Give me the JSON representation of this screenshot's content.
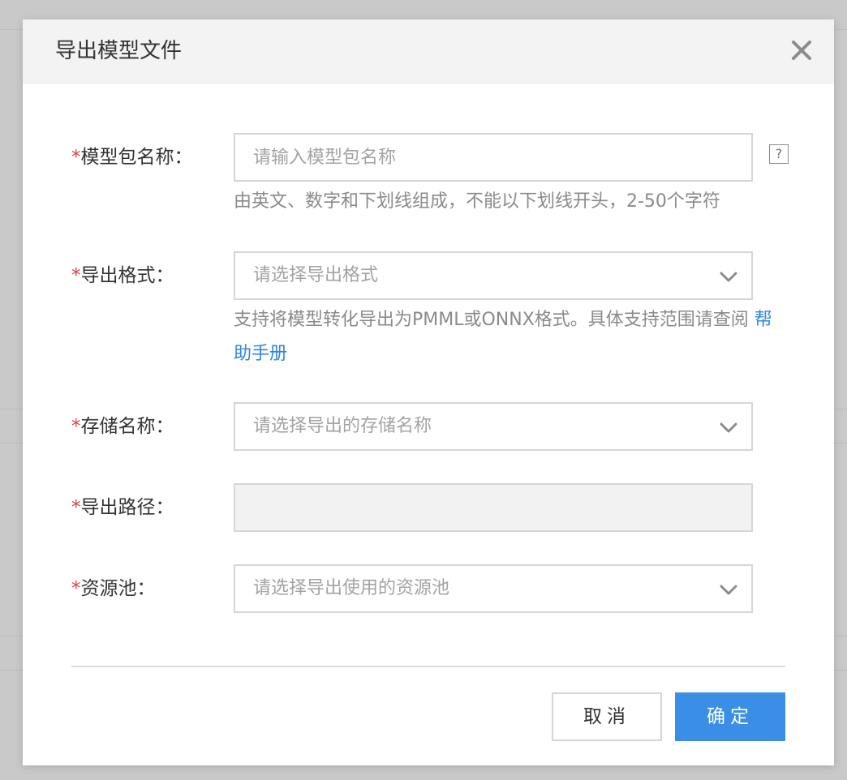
{
  "dialog": {
    "title": "导出模型文件",
    "close_icon": "close-icon"
  },
  "form": {
    "package_name": {
      "required_mark": "*",
      "label": "模型包名称：",
      "placeholder": "请输入模型包名称",
      "value": "",
      "help_icon": "question-icon",
      "help_glyph": "?",
      "hint": "由英文、数字和下划线组成，不能以下划线开头，2-50个字符"
    },
    "export_format": {
      "required_mark": "*",
      "label": "导出格式：",
      "placeholder": "请选择导出格式",
      "hint_text": "支持将模型转化导出为PMML或ONNX格式。具体支持范围请查阅",
      "hint_link": "帮助手册"
    },
    "storage_name": {
      "required_mark": "*",
      "label": "存储名称：",
      "placeholder": "请选择导出的存储名称"
    },
    "export_path": {
      "required_mark": "*",
      "label": "导出路径：",
      "value": ""
    },
    "resource_pool": {
      "required_mark": "*",
      "label": "资源池：",
      "placeholder": "请选择导出使用的资源池"
    }
  },
  "footer": {
    "cancel_label": "取消",
    "confirm_label": "确定"
  },
  "colors": {
    "required": "#e0413d",
    "link": "#2f86e0",
    "primary_button": "#3a8ee6"
  }
}
